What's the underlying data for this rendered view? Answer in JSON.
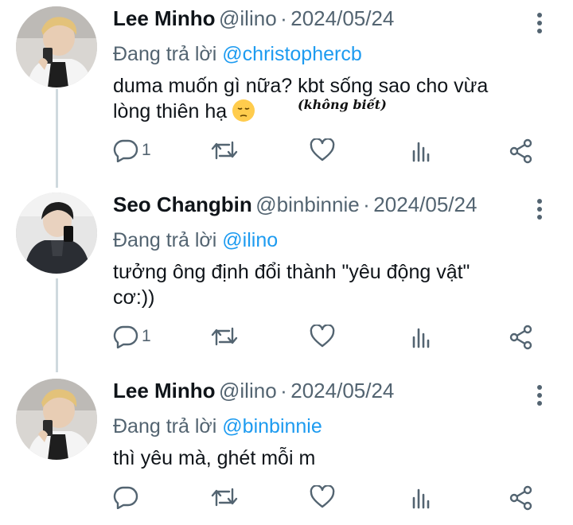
{
  "colors": {
    "link": "#1d9bf0",
    "secondary_text": "#536471",
    "primary_text": "#0f1419",
    "thread_line": "#cfd9de"
  },
  "tweets": [
    {
      "name": "Lee Minho",
      "handle": "@ilino",
      "separator": "·",
      "date": "2024/05/24",
      "reply_prefix": "Đang trả lời",
      "reply_to": "@christophercb",
      "text_line1": "duma muốn gì nữa? kbt sống sao cho vừa",
      "text_line2": "lòng thiên hạ",
      "emoji": "pensive-face",
      "annotation": "(không biết)",
      "reply_count": "1"
    },
    {
      "name": "Seo Changbin",
      "handle": "@binbinnie",
      "separator": "·",
      "date": "2024/05/24",
      "reply_prefix": "Đang trả lời",
      "reply_to": "@ilino",
      "text_line1": "tưởng ông định đổi thành \"yêu động vật\"",
      "text_line2": "cơ:))",
      "reply_count": "1"
    },
    {
      "name": "Lee Minho",
      "handle": "@ilino",
      "separator": "·",
      "date": "2024/05/24",
      "reply_prefix": "Đang trả lời",
      "reply_to": "@binbinnie",
      "text_line1": "thì yêu mà, ghét mỗi m",
      "reply_count": ""
    }
  ],
  "icons": [
    "reply-icon",
    "retweet-icon",
    "like-icon",
    "views-icon",
    "share-icon",
    "more-icon"
  ]
}
